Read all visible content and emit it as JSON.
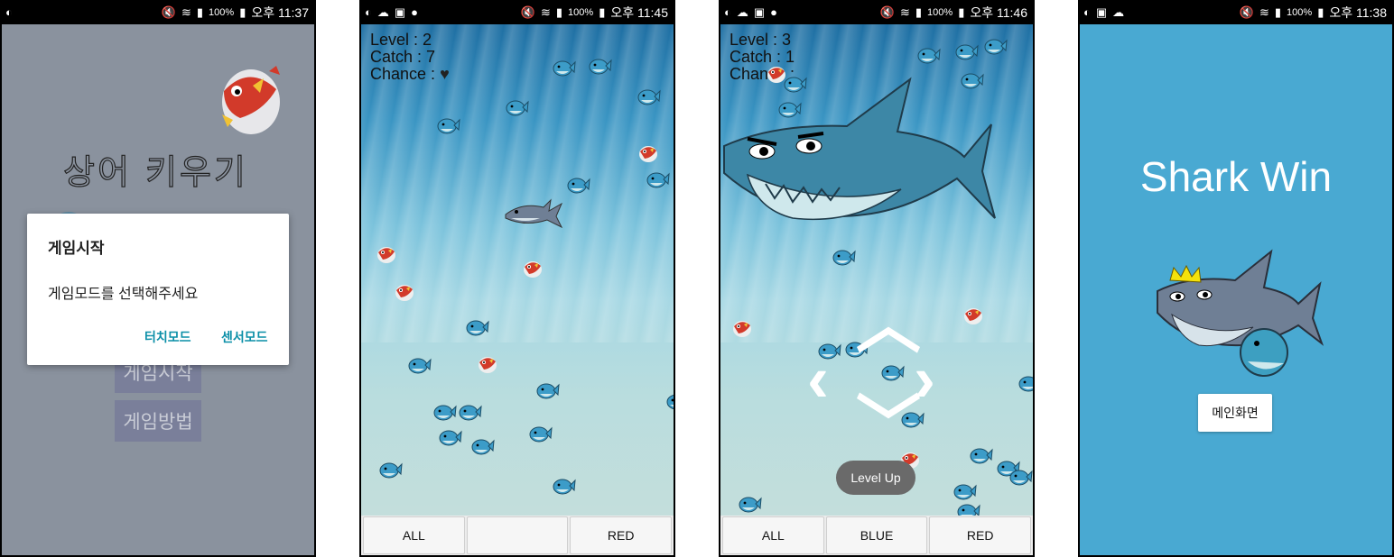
{
  "status_bars": [
    {
      "battery": "100%",
      "time": "오후 11:37"
    },
    {
      "battery": "100%",
      "time": "오후 11:45"
    },
    {
      "battery": "100%",
      "time": "오후 11:46"
    },
    {
      "battery": "100%",
      "time": "오후 11:38"
    }
  ],
  "screen1": {
    "app_title": "상어 키우기",
    "menu": {
      "start": "게임시작",
      "howto": "게임방법"
    },
    "dialog": {
      "title": "게임시작",
      "message": "게임모드를 선택해주세요",
      "touch_mode": "터치모드",
      "sensor_mode": "센서모드"
    }
  },
  "screen2": {
    "hud": {
      "level": "Level : 2",
      "catch": "Catch : 7",
      "chance": "Chance :"
    },
    "buttons": [
      "ALL",
      "",
      "RED"
    ]
  },
  "screen3": {
    "hud": {
      "level": "Level : 3",
      "catch": "Catch : 1",
      "chance": "Chance :"
    },
    "toast": "Level Up",
    "buttons": [
      "ALL",
      "BLUE",
      "RED"
    ]
  },
  "screen4": {
    "title": "Shark Win",
    "main_button": "메인화면"
  },
  "colors": {
    "dialog_accent": "#0b8fa8",
    "win_bg": "#49a9d2"
  }
}
